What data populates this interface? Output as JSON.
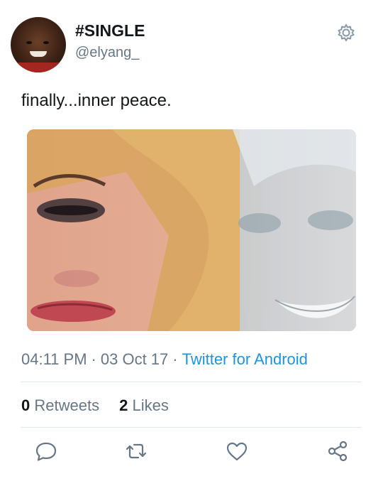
{
  "user": {
    "display_name": "#SINGLE",
    "handle": "@elyang_"
  },
  "tweet": {
    "text": "finally...inner peace.",
    "time": "04:11 PM",
    "date": "03 Oct 17",
    "separator": "·",
    "source": "Twitter for Android"
  },
  "stats": {
    "retweets_count": "0",
    "retweets_label": "Retweets",
    "likes_count": "2",
    "likes_label": "Likes"
  },
  "actions": [
    "reply-icon",
    "retweet-icon",
    "like-icon",
    "share-icon"
  ],
  "colors": {
    "text": "#14171a",
    "secondary": "#657786",
    "link": "#1b95e0",
    "divider": "#e1e8ed"
  }
}
